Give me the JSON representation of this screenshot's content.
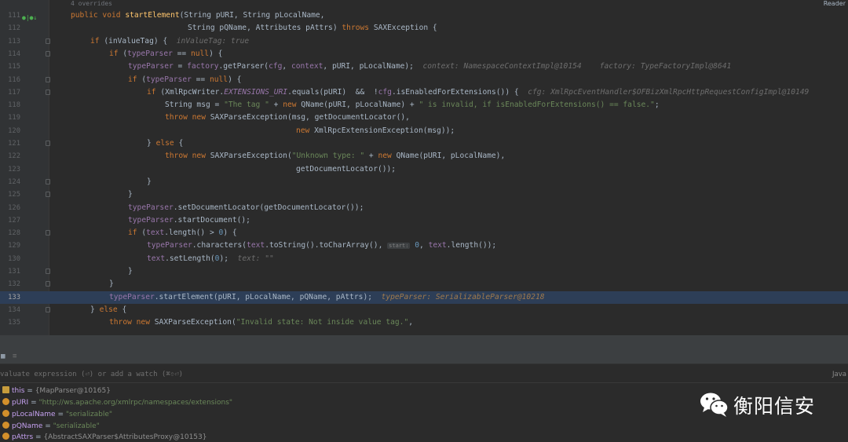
{
  "editor": {
    "overrides_hint": "4 overrides",
    "reader_label": "Reader",
    "lines": [
      {
        "n": "111",
        "gutter_icons": "●|●↓"
      },
      {
        "n": "112"
      },
      {
        "n": "113"
      },
      {
        "n": "114"
      },
      {
        "n": "115"
      },
      {
        "n": "116"
      },
      {
        "n": "117"
      },
      {
        "n": "118"
      },
      {
        "n": "119"
      },
      {
        "n": "120"
      },
      {
        "n": "121"
      },
      {
        "n": "122"
      },
      {
        "n": "123"
      },
      {
        "n": "124"
      },
      {
        "n": "125"
      },
      {
        "n": "126"
      },
      {
        "n": "127"
      },
      {
        "n": "128"
      },
      {
        "n": "129"
      },
      {
        "n": "130"
      },
      {
        "n": "131"
      },
      {
        "n": "132"
      },
      {
        "n": "133"
      },
      {
        "n": "134"
      },
      {
        "n": "135"
      }
    ],
    "code": {
      "l111": {
        "a": "public void ",
        "b": "startElement",
        "c": "(String pURI, String pLocalName,"
      },
      "l112": {
        "a": "String pQName, Attributes pAttrs) ",
        "b": "throws ",
        "c": "SAXException {"
      },
      "l113": {
        "a": "if ",
        "b": "(inValueTag) {  ",
        "c": "inValueTag: true"
      },
      "l114": {
        "a": "if ",
        "b": "(",
        "c": "typeParser",
        "d": " == ",
        "e": "null",
        "f": ") {"
      },
      "l115": {
        "a": "typeParser",
        "b": " = ",
        "c": "factory",
        "d": ".getParser(",
        "e": "cfg",
        "f": ", ",
        "g": "context",
        "h": ", pURI, pLocalName);  ",
        "i": "context: NamespaceContextImpl@10154    factory: TypeFactoryImpl@8641"
      },
      "l116": {
        "a": "if ",
        "b": "(",
        "c": "typeParser",
        "d": " == ",
        "e": "null",
        "f": ") {"
      },
      "l117": {
        "a": "if ",
        "b": "(XmlRpcWriter.",
        "c": "EXTENSIONS_URI",
        "d": ".equals(pURI)  &&  !",
        "e": "cfg",
        "f": ".isEnabledForExtensions()) {  ",
        "g": "cfg: XmlRpcEventHandler$OFBizXmlRpcHttpRequestConfigImpl@10149"
      },
      "l118": {
        "a": "String msg = ",
        "b": "\"The tag \"",
        "c": " + ",
        "d": "new ",
        "e": "QName(pURI, pLocalName) + ",
        "f": "\" is invalid, if isEnabledForExtensions() == false.\"",
        "g": ";"
      },
      "l119": {
        "a": "throw new ",
        "b": "SAXParseException(msg, getDocumentLocator(),"
      },
      "l120": {
        "a": "new ",
        "b": "XmlRpcExtensionException(msg));"
      },
      "l121": {
        "a": "} ",
        "b": "else ",
        "c": "{"
      },
      "l122": {
        "a": "throw new ",
        "b": "SAXParseException(",
        "c": "\"Unknown type: \"",
        "d": " + ",
        "e": "new ",
        "f": "QName(pURI, pLocalName),"
      },
      "l123": {
        "a": "getDocumentLocator());"
      },
      "l124": {
        "a": "}"
      },
      "l125": {
        "a": "}"
      },
      "l126": {
        "a": "typeParser",
        "b": ".setDocumentLocator(getDocumentLocator());"
      },
      "l127": {
        "a": "typeParser",
        "b": ".startDocument();"
      },
      "l128": {
        "a": "if ",
        "b": "(",
        "c": "text",
        "d": ".length() > ",
        "e": "0",
        "f": ") {"
      },
      "l129": {
        "a": "typeParser",
        "b": ".characters(",
        "c": "text",
        "d": ".toString().toCharArray(), ",
        "e": "start:",
        "f": " 0",
        "g": ", ",
        "h": "text",
        "i": ".length());"
      },
      "l130": {
        "a": "text",
        "b": ".setLength(",
        "c": "0",
        "d": ");  ",
        "e": "text: \"\""
      },
      "l131": {
        "a": "}"
      },
      "l132": {
        "a": "}"
      },
      "l133": {
        "a": "typeParser",
        "b": ".startElement(pURI, pLocalName, pQName, pAttrs);  ",
        "c": "typeParser: SerializableParser@10218"
      },
      "l134": {
        "a": "} ",
        "b": "else ",
        "c": "{"
      },
      "l135": {
        "a": "throw new ",
        "b": "SAXParseException(",
        "c": "\"Invalid state: Not inside value tag.\"",
        "d": ","
      }
    }
  },
  "debug": {
    "toolbar_icons": [
      "table-icon",
      "list-icon"
    ],
    "eval_placeholder": "valuate expression (⏎) or add a watch (⌘⇧⏎)",
    "lang_label": "Java",
    "variables": [
      {
        "name": "this",
        "value": "{MapParser@10165}",
        "icon": "sq"
      },
      {
        "name": "pURI",
        "value": "\"http://ws.apache.org/xmlrpc/namespaces/extensions\"",
        "icon": "p"
      },
      {
        "name": "pLocalName",
        "value": "\"serializable\"",
        "icon": "p"
      },
      {
        "name": "pQName",
        "value": "\"serializable\"",
        "icon": "p"
      },
      {
        "name": "pAttrs",
        "value": "{AbstractSAXParser$AttributesProxy@10153}",
        "icon": "p"
      }
    ]
  },
  "watermark": {
    "text": "衡阳信安"
  }
}
